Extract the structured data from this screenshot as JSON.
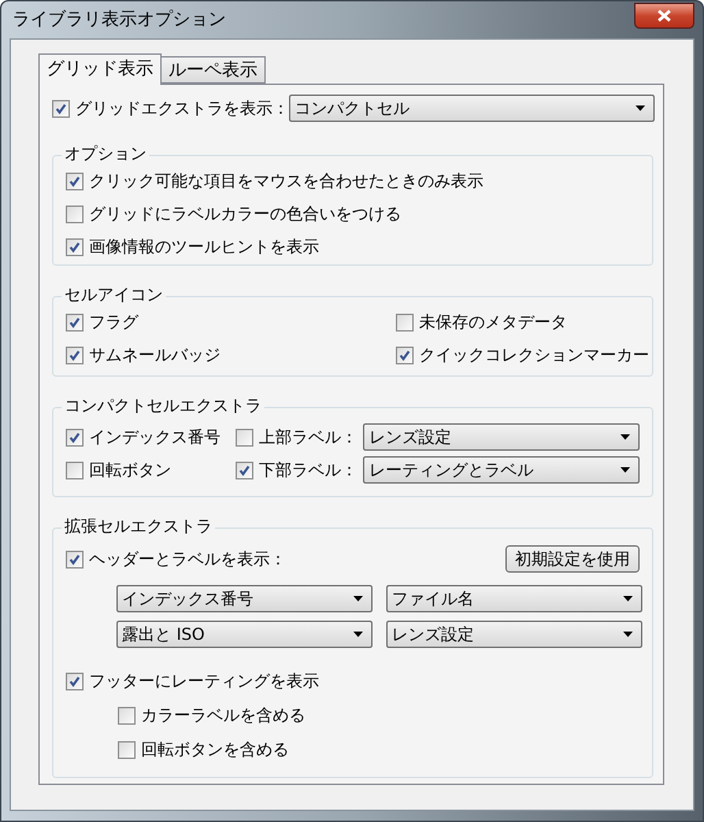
{
  "window": {
    "title": "ライブラリ表示オプション"
  },
  "tabs": [
    {
      "label": "グリッド表示",
      "selected": true
    },
    {
      "label": "ルーペ表示",
      "selected": false
    }
  ],
  "grid_extras": {
    "label": "グリッドエクストラを表示：",
    "checked": true,
    "dropdown": "コンパクトセル"
  },
  "options": {
    "title": "オプション",
    "items": [
      {
        "label": "クリック可能な項目をマウスを合わせたときのみ表示",
        "checked": true
      },
      {
        "label": "グリッドにラベルカラーの色合いをつける",
        "checked": false
      },
      {
        "label": "画像情報のツールヒントを表示",
        "checked": true
      }
    ]
  },
  "cell_icons": {
    "title": "セルアイコン",
    "items": [
      {
        "label": "フラグ",
        "checked": true
      },
      {
        "label": "未保存のメタデータ",
        "checked": false
      },
      {
        "label": "サムネールバッジ",
        "checked": true
      },
      {
        "label": "クイックコレクションマーカー",
        "checked": true
      }
    ]
  },
  "compact_extras": {
    "title": "コンパクトセルエクストラ",
    "rows": [
      {
        "label": "インデックス番号",
        "checked": true,
        "label_option": {
          "label": "上部ラベル：",
          "checked": false,
          "dropdown": "レンズ設定"
        }
      },
      {
        "label": "回転ボタン",
        "checked": false,
        "label_option": {
          "label": "下部ラベル：",
          "checked": true,
          "dropdown": "レーティングとラベル"
        }
      }
    ]
  },
  "expanded_extras": {
    "title": "拡張セルエクストラ",
    "header": {
      "label": "ヘッダーとラベルを表示：",
      "checked": true
    },
    "default_button": "初期設定を使用",
    "fields": [
      "インデックス番号",
      "ファイル名",
      "露出と ISO",
      "レンズ設定"
    ],
    "footer": {
      "label": "フッターにレーティングを表示",
      "checked": true,
      "sub_options": [
        {
          "label": "カラーラベルを含める",
          "checked": false
        },
        {
          "label": "回転ボタンを含める",
          "checked": false
        }
      ]
    }
  }
}
